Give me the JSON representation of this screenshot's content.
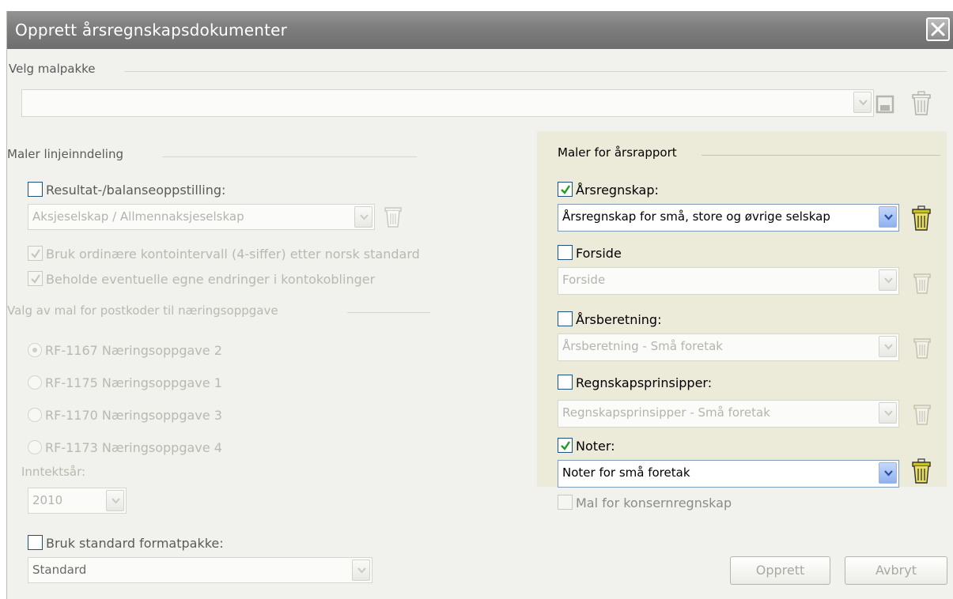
{
  "window": {
    "title": "Opprett årsregnskapsdokumenter"
  },
  "malpakke": {
    "group_label": "Velg malpakke",
    "value": ""
  },
  "left": {
    "group_label": "Maler linjeinndeling",
    "resultat": {
      "label": "Resultat-/balanseoppstilling:",
      "checked": false,
      "combo_value": "Aksjeselskap / Allmennaksjeselskap"
    },
    "opt_kontointervall": {
      "label": "Bruk ordinære kontointervall (4-siffer) etter norsk standard",
      "checked": true
    },
    "opt_beholde": {
      "label": "Beholde eventuelle egne endringer i kontokoblinger",
      "checked": true
    },
    "postkoder_label": "Valg av mal for postkoder til næringsoppgave",
    "radios": [
      {
        "label": "RF-1167 Næringsoppgave 2",
        "selected": true
      },
      {
        "label": "RF-1175 Næringsoppgave 1",
        "selected": false
      },
      {
        "label": "RF-1170 Næringsoppgave 3",
        "selected": false
      },
      {
        "label": "RF-1173 Næringsoppgave 4",
        "selected": false
      }
    ],
    "inntektsar_label": "Inntektsår:",
    "inntektsar_value": "2010",
    "formatpakke": {
      "label": "Bruk standard formatpakke:",
      "checked": false,
      "combo_value": "Standard"
    }
  },
  "right": {
    "group_label": "Maler for årsrapport",
    "arsregnskap": {
      "label": "Årsregnskap:",
      "checked": true,
      "combo_value": "Årsregnskap for små, store og øvrige selskap"
    },
    "forside": {
      "label": "Forside",
      "checked": false,
      "combo_value": "Forside"
    },
    "arsberetning": {
      "label": "Årsberetning:",
      "checked": false,
      "combo_value": "Årsberetning - Små foretak"
    },
    "prinsipper": {
      "label": "Regnskapsprinsipper:",
      "checked": false,
      "combo_value": "Regnskapsprinsipper - Små foretak"
    },
    "noter": {
      "label": "Noter:",
      "checked": true,
      "combo_value": "Noter for små foretak"
    }
  },
  "konsern": {
    "label": "Mal for konsernregnskap",
    "checked": false
  },
  "buttons": {
    "create": "Opprett",
    "cancel": "Avbryt"
  },
  "colors": {
    "title_bar": "#7d7d7d",
    "panel_bg": "#ecead8",
    "disabled_text": "#b9b9b1",
    "check_green": "#1e9c1e"
  }
}
